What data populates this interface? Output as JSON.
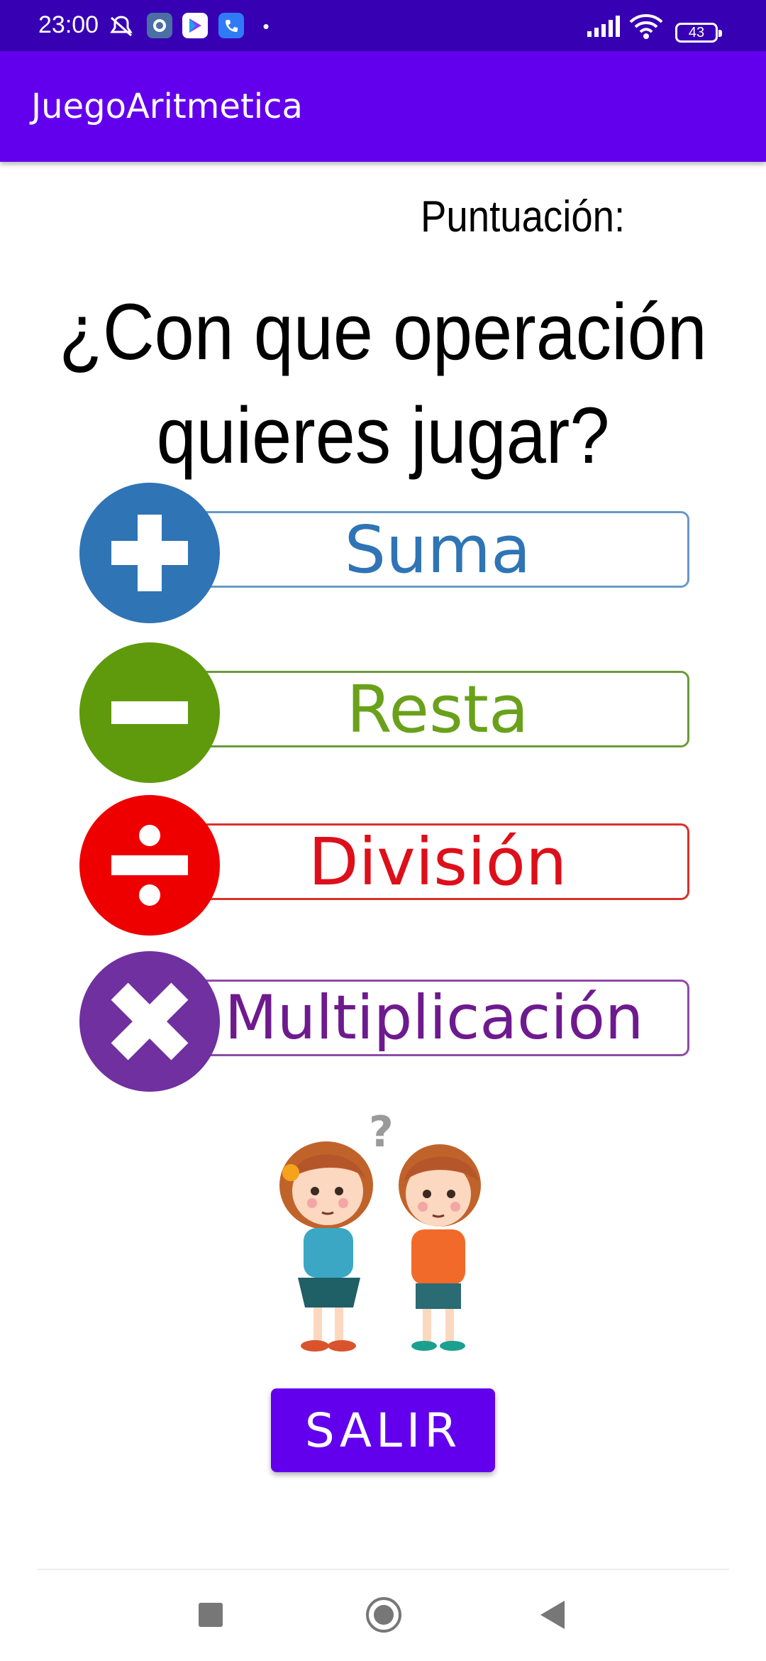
{
  "status_bar": {
    "time": "23:00",
    "battery": "43",
    "icons": [
      "silent-icon",
      "settings-app-icon",
      "play-store-icon",
      "phone-icon",
      "signal-icon",
      "wifi-icon",
      "battery-icon"
    ]
  },
  "app_bar": {
    "title": "JuegoAritmetica"
  },
  "score": {
    "label": "Puntuación:"
  },
  "question": {
    "line1": "¿Con que operación",
    "line2": "quieres jugar?"
  },
  "operations": [
    {
      "label": "Suma",
      "icon": "plus-icon",
      "color": "#2f74b5",
      "text_color": "#2f74b5"
    },
    {
      "label": "Resta",
      "icon": "minus-icon",
      "color": "#5e9a0c",
      "text_color": "#6aa11a"
    },
    {
      "label": "División",
      "icon": "divide-icon",
      "color": "#ee0000",
      "text_color": "#dd0f1a"
    },
    {
      "label": "Multiplicación",
      "icon": "multiply-icon",
      "color": "#7030a0",
      "text_color": "#6e1a8f"
    }
  ],
  "exit_button": {
    "label": "SALIR",
    "color": "#6200ee"
  },
  "navigation": {
    "icons": [
      "recent-apps-icon",
      "home-icon",
      "back-icon"
    ]
  }
}
